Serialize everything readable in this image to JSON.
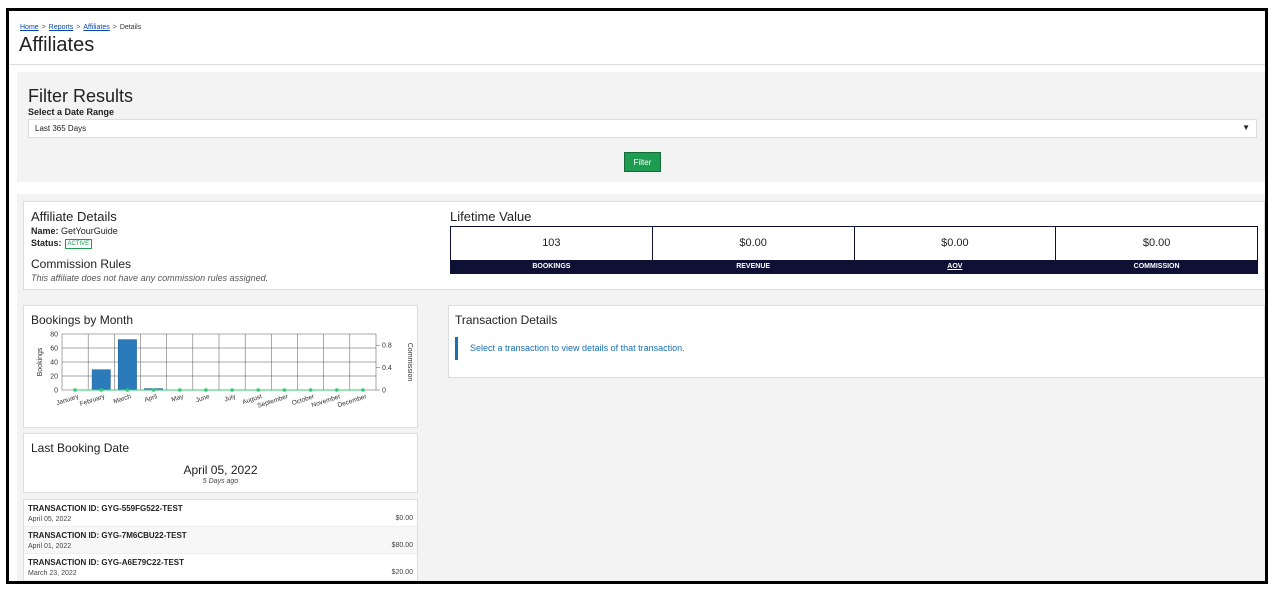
{
  "breadcrumb": {
    "home": "Home",
    "reports": "Reports",
    "affiliates": "Affiliates",
    "current": "Details",
    "separator": ">"
  },
  "page_title": "Affiliates",
  "filter": {
    "title": "Filter Results",
    "date_label": "Select a Date Range",
    "date_value": "Last 365 Days",
    "button": "Filter"
  },
  "affiliate": {
    "title": "Affiliate Details",
    "name_label": "Name:",
    "name_value": "GetYourGuide",
    "status_label": "Status:",
    "status_value": "ACTIVE",
    "rules_title": "Commission Rules",
    "rules_text": "This affiliate does not have any commission rules assigned."
  },
  "lifetime": {
    "title": "Lifetime Value",
    "cells": [
      {
        "value": "103",
        "label": "BOOKINGS"
      },
      {
        "value": "$0.00",
        "label": "REVENUE"
      },
      {
        "value": "$0.00",
        "label": "AOV"
      },
      {
        "value": "$0.00",
        "label": "COMMISSION"
      }
    ]
  },
  "bookings_chart_title": "Bookings by Month",
  "chart_data": {
    "type": "bar",
    "categories": [
      "January",
      "February",
      "March",
      "April",
      "May",
      "June",
      "July",
      "August",
      "September",
      "October",
      "November",
      "December"
    ],
    "series": [
      {
        "name": "Bookings",
        "values": [
          0,
          29,
          72,
          2,
          0,
          0,
          0,
          0,
          0,
          0,
          0,
          0
        ],
        "axis": "left",
        "color": "#2b7bba"
      },
      {
        "name": "Commission",
        "values": [
          0,
          0,
          0,
          0,
          0,
          0,
          0,
          0,
          0,
          0,
          0,
          0
        ],
        "axis": "right",
        "type": "line",
        "color": "#2ecc71"
      }
    ],
    "ylabel": "Bookings",
    "y2label": "Commission",
    "ylim": [
      0,
      80
    ],
    "y2lim": [
      0,
      1
    ],
    "yticks": [
      "0",
      "20",
      "40",
      "60",
      "80"
    ],
    "y2ticks": [
      "0",
      "0.4",
      "0.8"
    ],
    "grid": true
  },
  "last_booking": {
    "title": "Last Booking Date",
    "date": "April 05, 2022",
    "ago": "5 Days ago"
  },
  "transactions": [
    {
      "id": "TRANSACTION ID: GYG-559FG522-TEST",
      "date": "April 05, 2022",
      "amount": "$0.00"
    },
    {
      "id": "TRANSACTION ID: GYG-7M6CBU22-TEST",
      "date": "April 01, 2022",
      "amount": "$80.00"
    },
    {
      "id": "TRANSACTION ID: GYG-A6E79C22-TEST",
      "date": "March 23, 2022",
      "amount": "$20.00"
    }
  ],
  "transaction_details": {
    "title": "Transaction Details",
    "hint": "Select a transaction to view details of that transaction."
  },
  "colors": {
    "accent": "#1e9c52",
    "navy": "#0e1133",
    "link": "#1a6fb0"
  }
}
